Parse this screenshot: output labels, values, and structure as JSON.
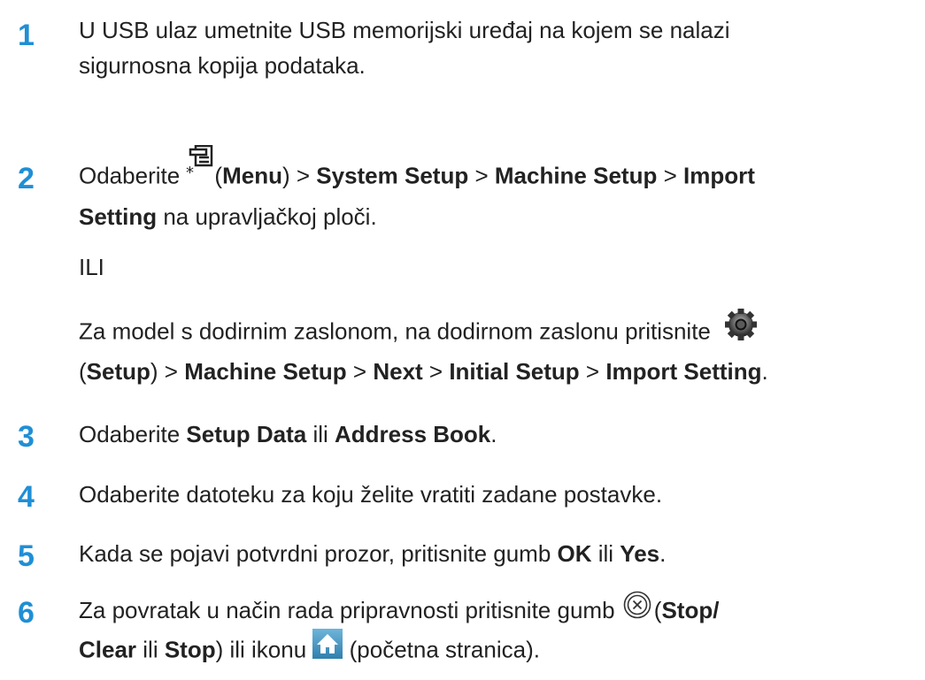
{
  "colors": {
    "step_number": "#1f8fd6",
    "text": "#222222",
    "home_icon_bg": "#4a9ec9"
  },
  "steps": [
    {
      "number": "1",
      "lines": [
        "U USB ulaz umetnite USB memorijski uređaj na kojem se nalazi",
        "sigurnosna kopija podataka."
      ]
    },
    {
      "number": "2",
      "t1": "Odaberite ",
      "t2": "(",
      "menu": "Menu",
      "t3": ") > ",
      "system_setup": "System Setup",
      "t4": " > ",
      "machine_setup": "Machine Setup",
      "t5": " > ",
      "import": "Import",
      "setting": "Setting",
      "t6": " na upravljačkoj ploči.",
      "or": "ILI",
      "alt_t1": "Za model s dodirnim zaslonom, na dodirnom zaslonu pritisnite",
      "alt_t2": "(",
      "setup": "Setup",
      "alt_t3": ") > ",
      "alt_machine_setup": "Machine Setup",
      "alt_t4": " > ",
      "next": "Next",
      "alt_t5": " > ",
      "initial_setup": "Initial Setup",
      "alt_t6": " > ",
      "import_setting": "Import Setting",
      "alt_t7": ".",
      "icons": {
        "menu": "menu-icon",
        "setup": "gear-icon"
      }
    },
    {
      "number": "3",
      "t1": "Odaberite ",
      "setup_data": "Setup Data",
      "t2": " ili ",
      "address_book": "Address Book",
      "t3": "."
    },
    {
      "number": "4",
      "text": "Odaberite datoteku za koju želite vratiti zadane postavke."
    },
    {
      "number": "5",
      "t1": "Kada se pojavi potvrdni prozor, pritisnite gumb ",
      "ok": "OK",
      "t2": " ili ",
      "yes": "Yes",
      "t3": "."
    },
    {
      "number": "6",
      "t1": "Za povratak u način rada pripravnosti pritisnite gumb ",
      "t2": "(",
      "stop_clear": "Stop/",
      "clear": "Clear",
      "t3": " ili ",
      "stop": "Stop",
      "t4": ") ili ikonu ",
      "t5": " (početna stranica).",
      "icons": {
        "stop": "stop-clear-icon",
        "home": "home-icon"
      }
    }
  ]
}
